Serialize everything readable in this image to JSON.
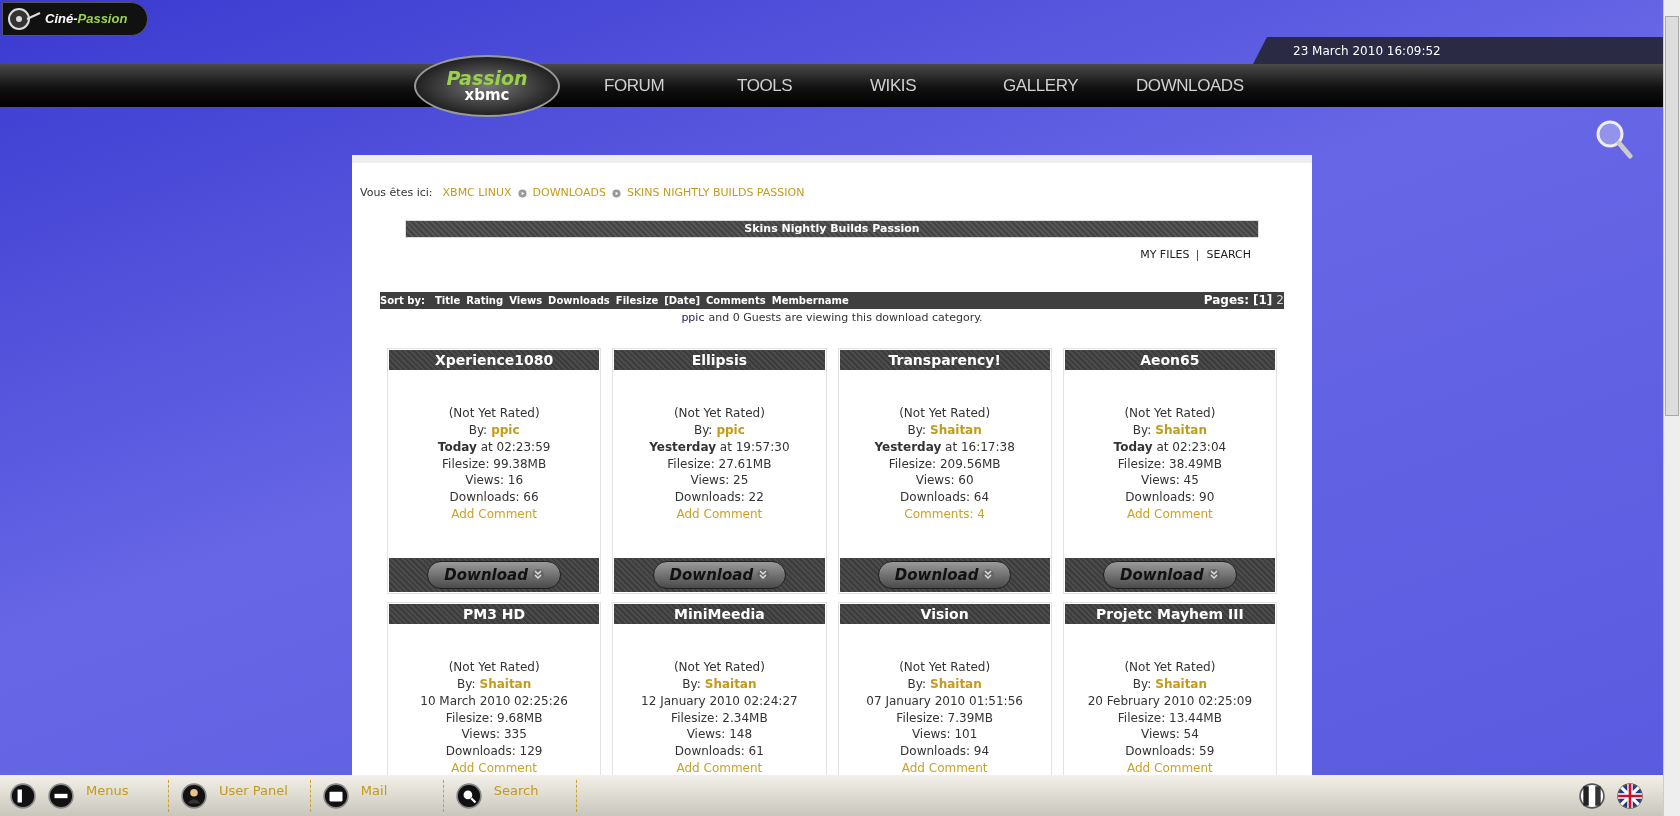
{
  "brand": {
    "parts": [
      "Ciné-",
      "Passion"
    ]
  },
  "datetime": "23 March 2010 16:09:52",
  "nav": {
    "logo": {
      "top": "Passion",
      "bottom": "xbmc"
    },
    "items": [
      {
        "label": "FORUM"
      },
      {
        "label": "TOOLS"
      },
      {
        "label": "WIKIS"
      },
      {
        "label": "GALLERY"
      },
      {
        "label": "DOWNLOADS"
      }
    ]
  },
  "breadcrumb": {
    "prefix": "Vous êtes ici:",
    "items": [
      "XBMC LINUX",
      "DOWNLOADS",
      "SKINS NIGHTLY BUILDS PASSION"
    ]
  },
  "category_title": "Skins Nightly Builds Passion",
  "links": [
    "MY FILES",
    "SEARCH"
  ],
  "sort_bar": {
    "label": "Sort by:",
    "options": [
      "Title",
      "Rating",
      "Views",
      "Downloads",
      "Filesize",
      "[Date]",
      "Comments",
      "Membername"
    ],
    "pages_label": "Pages:",
    "pages": [
      {
        "label": "[1]",
        "selected": true
      },
      {
        "label": "2",
        "selected": false
      }
    ]
  },
  "viewers": {
    "user": "ppic",
    "text": "and 0 Guests are viewing this download category."
  },
  "files": [
    {
      "title": "Xperience1080",
      "rating": "(Not Yet Rated)",
      "by_label": "By:",
      "author": "ppic",
      "date": "**Today** at 02:23:59",
      "filesize": "Filesize: 99.38MB",
      "views": "Views: 16",
      "downloads": "Downloads: 66",
      "comment_link": "Add Comment",
      "download_label": "Download"
    },
    {
      "title": "Ellipsis",
      "rating": "(Not Yet Rated)",
      "by_label": "By:",
      "author": "ppic",
      "date": "**Yesterday** at 19:57:30",
      "filesize": "Filesize: 27.61MB",
      "views": "Views: 25",
      "downloads": "Downloads: 22",
      "comment_link": "Add Comment",
      "download_label": "Download"
    },
    {
      "title": "Transparency!",
      "rating": "(Not Yet Rated)",
      "by_label": "By:",
      "author": "Shaitan",
      "date": "**Yesterday** at 16:17:38",
      "filesize": "Filesize: 209.56MB",
      "views": "Views: 60",
      "downloads": "Downloads: 64",
      "comment_link": "Comments: 4",
      "download_label": "Download"
    },
    {
      "title": "Aeon65",
      "rating": "(Not Yet Rated)",
      "by_label": "By:",
      "author": "Shaitan",
      "date": "**Today** at 02:23:04",
      "filesize": "Filesize: 38.49MB",
      "views": "Views: 45",
      "downloads": "Downloads: 90",
      "comment_link": "Add Comment",
      "download_label": "Download"
    },
    {
      "title": "PM3 HD",
      "rating": "(Not Yet Rated)",
      "by_label": "By:",
      "author": "Shaitan",
      "date": "10 March 2010 02:25:26",
      "filesize": "Filesize: 9.68MB",
      "views": "Views: 335",
      "downloads": "Downloads: 129",
      "comment_link": "Add Comment"
    },
    {
      "title": "MiniMeedia",
      "rating": "(Not Yet Rated)",
      "by_label": "By:",
      "author": "Shaitan",
      "date": "12 January 2010 02:24:27",
      "filesize": "Filesize: 2.34MB",
      "views": "Views: 148",
      "downloads": "Downloads: 61",
      "comment_link": "Add Comment"
    },
    {
      "title": "Vision",
      "rating": "(Not Yet Rated)",
      "by_label": "By:",
      "author": "Shaitan",
      "date": "07 January 2010 01:51:56",
      "filesize": "Filesize: 7.39MB",
      "views": "Views: 101",
      "downloads": "Downloads: 94",
      "comment_link": "Add Comment"
    },
    {
      "title": "Projetc Mayhem III",
      "rating": "(Not Yet Rated)",
      "by_label": "By:",
      "author": "Shaitan",
      "date": "20 February 2010 02:25:09",
      "filesize": "Filesize: 13.44MB",
      "views": "Views: 54",
      "downloads": "Downloads: 59",
      "comment_link": "Add Comment"
    }
  ],
  "bottom_bar": {
    "items": [
      {
        "label": "Menus",
        "kind": "menus"
      },
      {
        "label": "User Panel",
        "kind": "user"
      },
      {
        "label": "Mail",
        "kind": "mail"
      },
      {
        "label": "Search",
        "kind": "search"
      }
    ]
  }
}
